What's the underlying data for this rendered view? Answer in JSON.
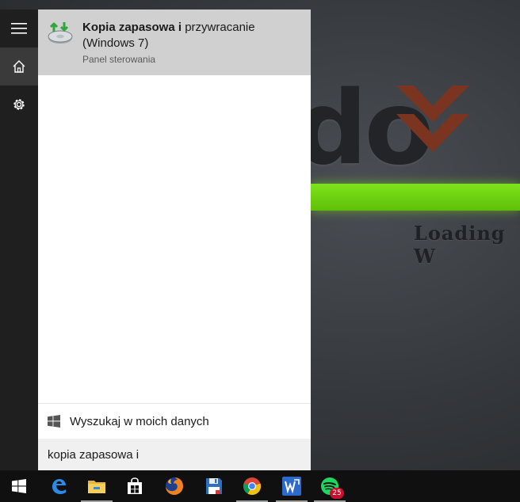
{
  "result": {
    "title_bold": "Kopia zapasowa i",
    "title_rest": " przywracanie (Windows 7)",
    "subtitle": "Panel sterowania"
  },
  "search_web": {
    "label": "Wyszukaj w moich danych"
  },
  "search_box": {
    "value": "kopia zapasowa i"
  },
  "wallpaper": {
    "brand": "do",
    "loading": "Loading W"
  },
  "rail": [
    {
      "icon": "hamburger-menu-icon"
    },
    {
      "icon": "home-icon",
      "active": true
    },
    {
      "icon": "settings-gear-icon"
    }
  ],
  "taskbar": {
    "items": [
      {
        "icon": "windows-start-icon"
      },
      {
        "icon": "edge-browser-icon"
      },
      {
        "icon": "file-explorer-icon",
        "running": true
      },
      {
        "icon": "store-icon"
      },
      {
        "icon": "firefox-icon"
      },
      {
        "icon": "floppy-save-icon"
      },
      {
        "icon": "chrome-icon",
        "running": true
      },
      {
        "icon": "wps-writer-icon",
        "running": true
      },
      {
        "icon": "spotify-icon",
        "running": true
      }
    ],
    "spotify_badge": "25"
  },
  "colors": {
    "panel_bg": "#ffffff",
    "result_highlight": "#d0d0d0",
    "rail_bg": "#1f1f1f",
    "taskbar_bg": "#101010",
    "loading_bar": "#6fd312"
  }
}
